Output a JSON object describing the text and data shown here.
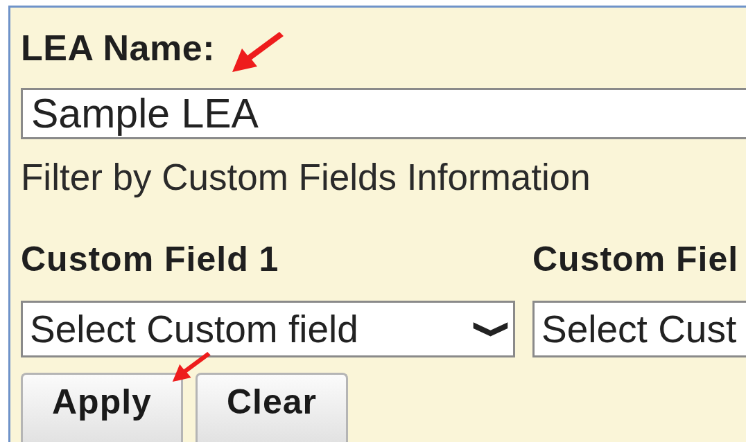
{
  "lea_name": {
    "label": "LEA Name:",
    "value": "Sample LEA"
  },
  "filter_heading": "Filter by Custom Fields Information",
  "custom_fields": [
    {
      "label": "Custom Field 1",
      "placeholder": "Select Custom field",
      "chevron": "❯"
    },
    {
      "label": "Custom Fiel",
      "placeholder": "Select Cust"
    }
  ],
  "buttons": [
    "Apply",
    "Clear"
  ]
}
